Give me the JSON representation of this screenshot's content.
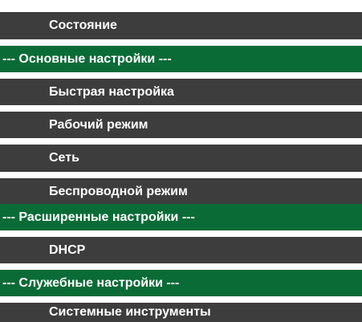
{
  "menu": {
    "items": [
      {
        "type": "item",
        "label": "Состояние"
      },
      {
        "type": "section",
        "label": "--- Основные настройки ---"
      },
      {
        "type": "item",
        "label": "Быстрая настройка"
      },
      {
        "type": "item",
        "label": "Рабочий режим"
      },
      {
        "type": "item",
        "label": "Сеть"
      },
      {
        "type": "item",
        "label": "Беспроводной режим"
      },
      {
        "type": "section",
        "label": "--- Расширенные настройки ---"
      },
      {
        "type": "item",
        "label": "DHCP"
      },
      {
        "type": "section",
        "label": "--- Служебные настройки ---"
      },
      {
        "type": "item",
        "label": "Системные инструменты"
      }
    ]
  },
  "colors": {
    "item_background": "#3d3d3d",
    "section_background": "#0b6b37",
    "text": "#ffffff",
    "page_background": "#ffffff"
  }
}
